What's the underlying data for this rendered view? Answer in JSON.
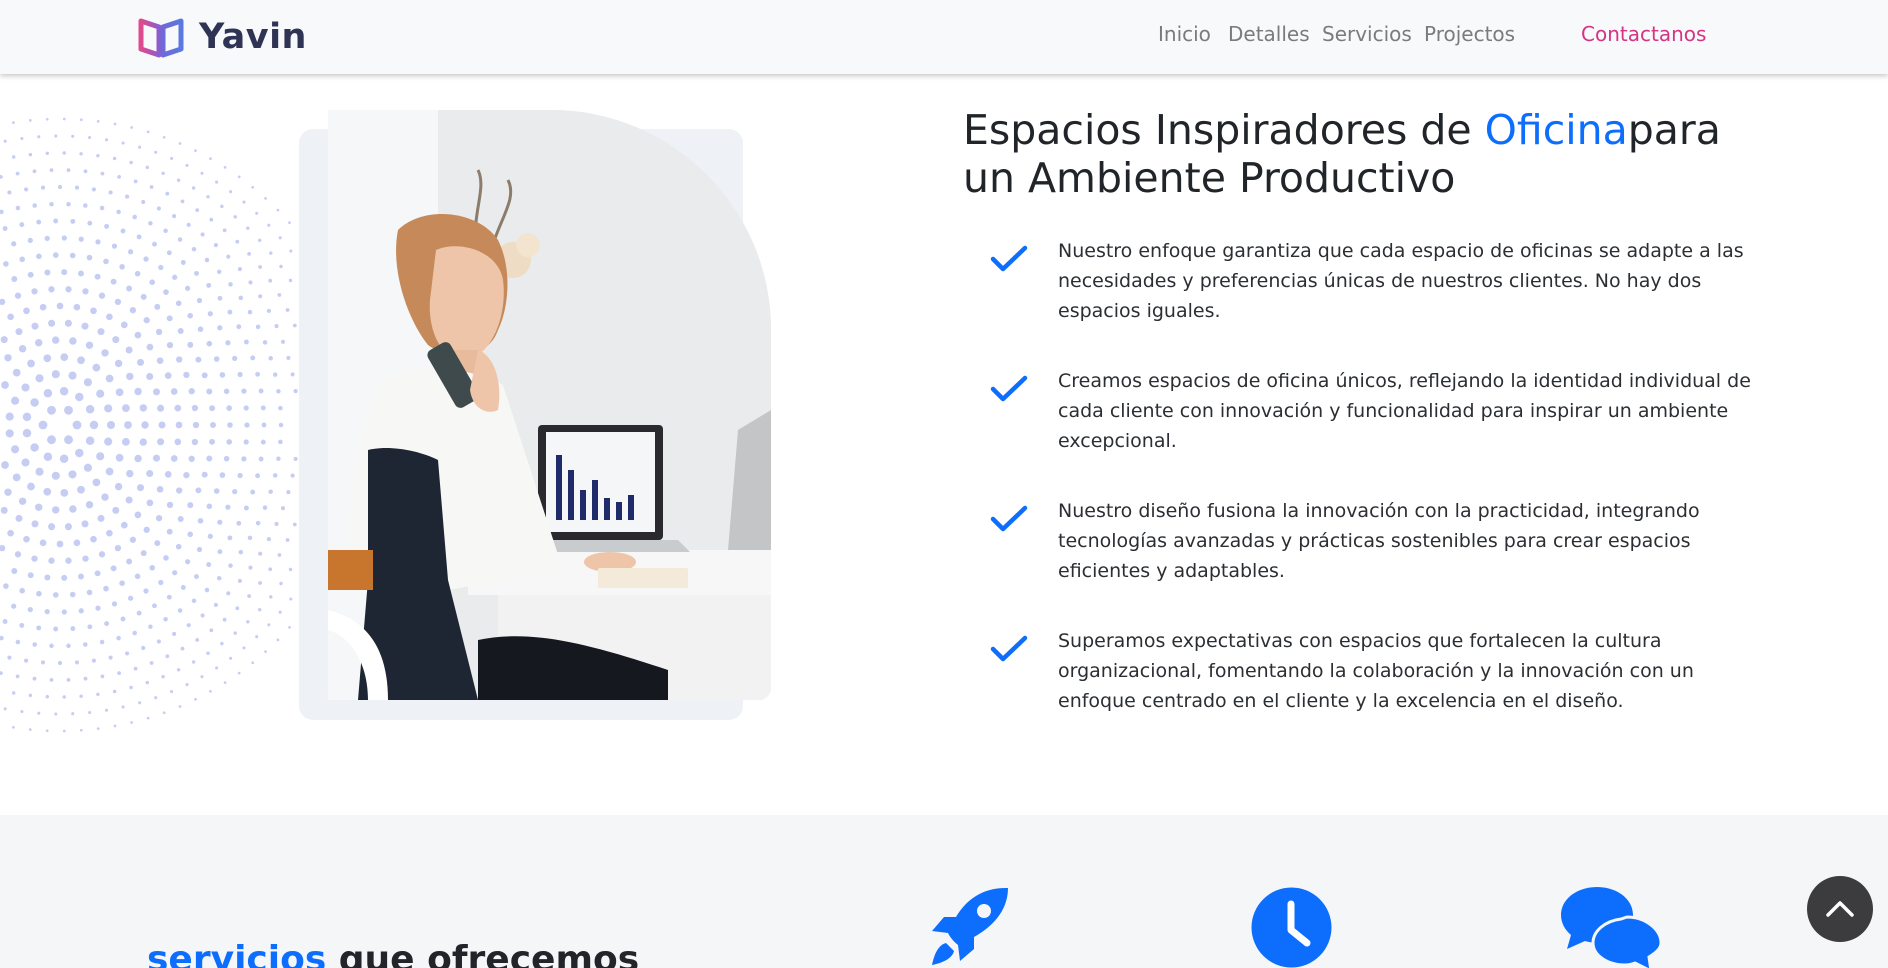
{
  "navbar": {
    "brand": "Yavin",
    "links": [
      "Inicio",
      "Detalles",
      "Servicios",
      "Projectos"
    ],
    "contact": "Contactanos"
  },
  "about": {
    "heading_part1": "Espacios Inspiradores de ",
    "heading_accent": "Oficina",
    "heading_part2": "para un Ambiente Productivo",
    "features": [
      "Nuestro enfoque garantiza que cada espacio de oficinas se adapte a las necesidades y preferencias únicas de nuestros clientes. No hay dos espacios iguales.",
      "Creamos espacios de oficina únicos, reflejando la identidad individual de cada cliente con innovación y funcionalidad para inspirar un ambiente excepcional.",
      "Nuestro diseño fusiona la innovación con la practicidad, integrando tecnologías avanzadas y prácticas sostenibles para crear espacios eficientes y adaptables.",
      "Superamos expectativas con espacios que fortalecen la cultura organizacional, fomentando la colaboración y la innovación con un enfoque centrado en el cliente y la excelencia en el diseño."
    ]
  },
  "services": {
    "title_accent": "servicios",
    "title_rest": " que ofrecemos",
    "icons": [
      "rocket-icon",
      "clock-icon",
      "chat-icon"
    ]
  },
  "colors": {
    "accent": "#0d6efd",
    "brand_pink": "#d63384",
    "nav_text": "#7b7b7b",
    "navbar_bg": "#f8f9fa",
    "section_bg": "#f5f6f8"
  }
}
